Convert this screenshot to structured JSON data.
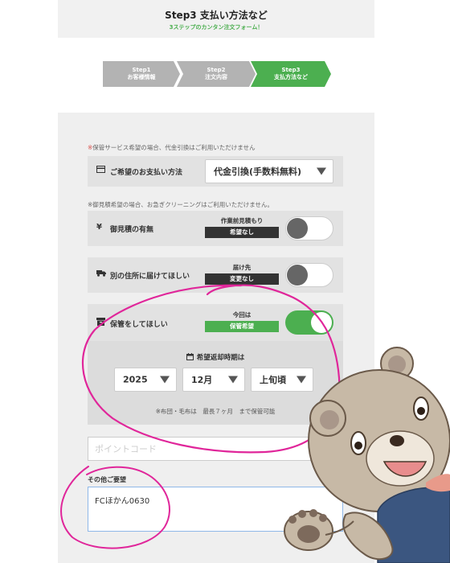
{
  "header": {
    "title": "Step3 支払い方法など",
    "subtitle": "3ステップのカンタン注文フォーム！"
  },
  "steps": [
    {
      "line1": "Step1",
      "line2": "お客様情報",
      "active": false
    },
    {
      "line1": "Step2",
      "line2": "注文内容",
      "active": false
    },
    {
      "line1": "Step3",
      "line2": "支払方法など",
      "active": true
    }
  ],
  "payment": {
    "notice_mark": "※",
    "notice": "保管サービス希望の場合、代金引換はご利用いただけません",
    "label": "ご希望のお支払い方法",
    "selected": "代金引換(手数料無料)"
  },
  "estimate": {
    "notice": "※御見積希望の場合、お急ぎクリーニングはご利用いただけません。",
    "label": "御見積の有無",
    "status_caption": "作業前見積もり",
    "status_value": "希望なし",
    "toggle_on": false
  },
  "delivery": {
    "label": "別の住所に届けてほしい",
    "status_caption": "届け先",
    "status_value": "変更なし",
    "toggle_on": false
  },
  "storage": {
    "label": "保管をしてほしい",
    "status_caption": "今回は",
    "status_value": "保管希望",
    "toggle_on": true
  },
  "return_period": {
    "title": "希望返却時期は",
    "year": "2025",
    "month": "12月",
    "period": "上旬頃",
    "note": "※布団・毛布は　最長７ヶ月　まで保管可能"
  },
  "point": {
    "placeholder": "ポイントコード"
  },
  "request": {
    "label": "その他ご要望",
    "value": "FCほかん0630"
  },
  "colors": {
    "accent_green": "#4caf50",
    "step_inactive": "#b3b3b3",
    "annotation_magenta": "#e0269a"
  }
}
